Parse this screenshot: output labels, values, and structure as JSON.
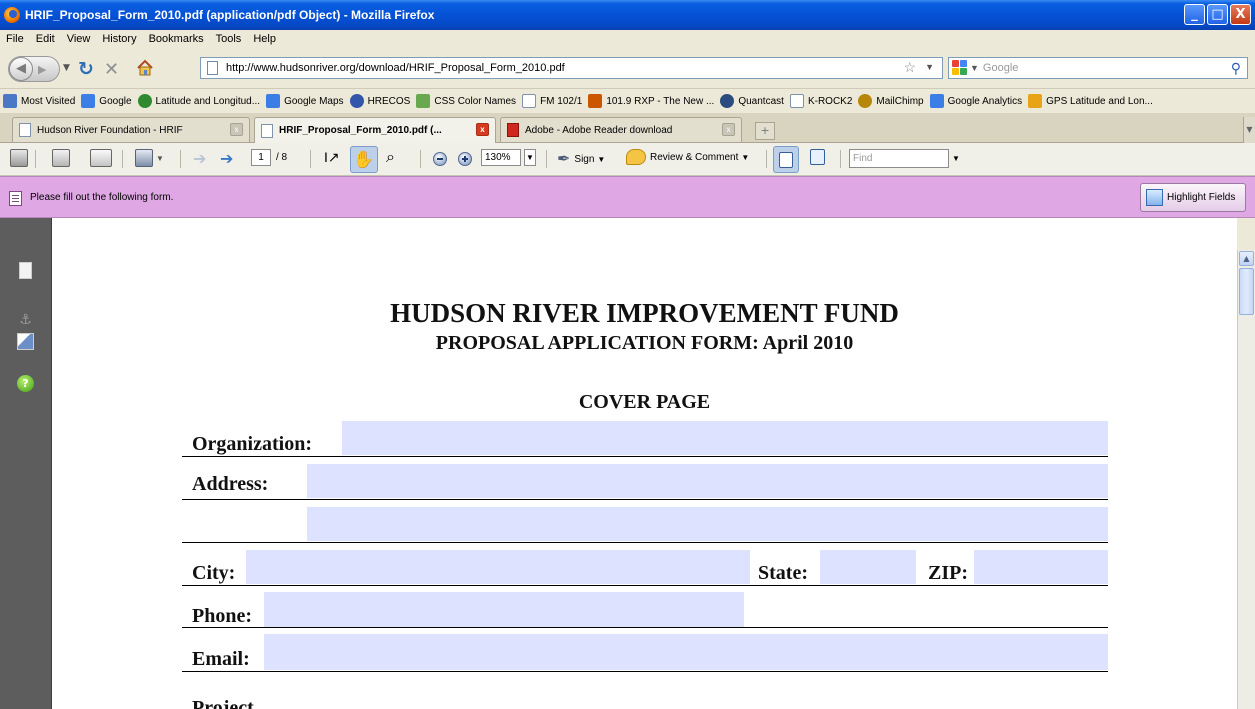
{
  "window": {
    "title": "HRIF_Proposal_Form_2010.pdf (application/pdf Object) - Mozilla Firefox",
    "controls": [
      "_",
      "□",
      "X"
    ]
  },
  "menu": [
    "File",
    "Edit",
    "View",
    "History",
    "Bookmarks",
    "Tools",
    "Help"
  ],
  "nav": {
    "url": "http://www.hudsonriver.org/download/HRIF_Proposal_Form_2010.pdf",
    "search_placeholder": "Google"
  },
  "bookmarks": [
    {
      "label": "Most Visited",
      "icon": "most-visited-icon",
      "color": "#4a78c7"
    },
    {
      "label": "Google",
      "icon": "google-icon",
      "color": "#3d7ee6"
    },
    {
      "label": "Latitude and Longitud...",
      "icon": "globe-icon",
      "color": "#2f8a2f"
    },
    {
      "label": "Google Maps",
      "icon": "google-icon",
      "color": "#3d7ee6"
    },
    {
      "label": "HRECOS",
      "icon": "hrecos-icon",
      "color": "#3355aa"
    },
    {
      "label": "CSS Color Names",
      "icon": "css-icon",
      "color": "#6aa84f"
    },
    {
      "label": "FM 102/1",
      "icon": "page-icon",
      "color": "#ffffff"
    },
    {
      "label": "101.9 RXP - The New ...",
      "icon": "rxp-icon",
      "color": "#cc5500"
    },
    {
      "label": "Quantcast",
      "icon": "quantcast-icon",
      "color": "#2b4c7e"
    },
    {
      "label": "K-ROCK2",
      "icon": "page-icon",
      "color": "#ffffff"
    },
    {
      "label": "MailChimp",
      "icon": "mailchimp-icon",
      "color": "#b8860b"
    },
    {
      "label": "Google Analytics",
      "icon": "google-icon",
      "color": "#3d7ee6"
    },
    {
      "label": "GPS Latitude and Lon...",
      "icon": "gps-icon",
      "color": "#e8a317"
    }
  ],
  "tabs": [
    {
      "label": "Hudson River Foundation - HRIF",
      "active": false
    },
    {
      "label": "HRIF_Proposal_Form_2010.pdf (...",
      "active": true
    },
    {
      "label": "Adobe - Adobe Reader download",
      "active": false
    }
  ],
  "reader_toolbar": {
    "page_current": "1",
    "page_total": "/ 8",
    "zoom": "130%",
    "sign_label": "Sign",
    "review_label": "Review & Comment",
    "find_placeholder": "Find"
  },
  "form_bar": {
    "message": "Please fill out the following form.",
    "highlight_label": "Highlight Fields",
    "color": "#dfa7e4"
  },
  "document": {
    "title": "HUDSON RIVER IMPROVEMENT FUND",
    "subtitle": "PROPOSAL APPLICATION FORM: April 2010",
    "section": "COVER PAGE",
    "labels": {
      "organization": "Organization:",
      "address": "Address:",
      "city": "City:",
      "state": "State:",
      "zip": "ZIP:",
      "phone": "Phone:",
      "email": "Email:",
      "project": "Project"
    },
    "field_color": "#dde3ff"
  }
}
